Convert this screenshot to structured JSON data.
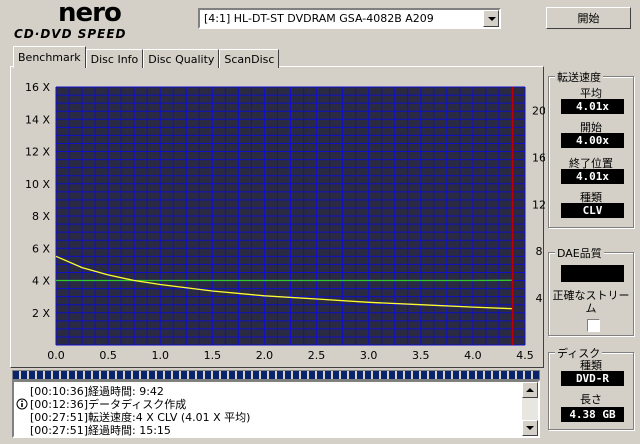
{
  "app": {
    "logo_text": "nero",
    "logo_subtext": "CD·DVD SPEED"
  },
  "drive": {
    "selected": "[4:1]   HL-DT-ST DVDRAM GSA-4082B  A209"
  },
  "toolbar": {
    "start_label": "開始"
  },
  "tabs": [
    {
      "label": "Benchmark",
      "active": true
    },
    {
      "label": "Disc Info",
      "active": false
    },
    {
      "label": "Disc Quality",
      "active": false
    },
    {
      "label": "ScanDisc",
      "active": false
    }
  ],
  "transfer": {
    "title": "転送速度",
    "average_label": "平均",
    "average_value": "4.01x",
    "start_label": "開始",
    "start_value": "4.00x",
    "end_label": "終了位置",
    "end_value": "4.01x",
    "type_label": "種類",
    "type_value": "CLV"
  },
  "dae": {
    "title": "DAE品質",
    "streaming_label": "正確なストリーム"
  },
  "disc": {
    "title": "ディスク",
    "type_label": "種類",
    "type_value": "DVD-R",
    "length_label": "長さ",
    "length_value": "4.38 GB"
  },
  "log": [
    {
      "time": "[00:10:36]",
      "text": "経過時間:  9:42",
      "icon": ""
    },
    {
      "time": "[00:12:36]",
      "text": "データディスク作成",
      "icon": "info-icon"
    },
    {
      "time": "[00:27:51]",
      "text": "転送速度:4 X CLV (4.01 X 平均)",
      "icon": ""
    },
    {
      "time": "[00:27:51]",
      "text": "経過時間: 15:15",
      "icon": ""
    }
  ],
  "colors": {
    "plot_bg": "#2a2a42",
    "grid": "#1010c8",
    "speed_line": "#ffff30",
    "rpm_line": "#30c830",
    "end_marker": "#c00000"
  },
  "chart_data": {
    "type": "line",
    "xlim": [
      0,
      4.5
    ],
    "ylim_left": [
      0,
      16
    ],
    "ylim_right": [
      0,
      22
    ],
    "x_ticks": [
      "0.0",
      "0.5",
      "1.0",
      "1.5",
      "2.0",
      "2.5",
      "3.0",
      "3.5",
      "4.0",
      "4.5"
    ],
    "y_ticks_left": [
      "2 X",
      "4 X",
      "6 X",
      "8 X",
      "10 X",
      "12 X",
      "14 X",
      "16 X"
    ],
    "y_ticks_right": [
      "4",
      "8",
      "12",
      "16",
      "20"
    ],
    "end_marker_x": 4.38,
    "series": [
      {
        "x": [
          0.0,
          0.25,
          0.5,
          0.75,
          1.0,
          1.5,
          2.0,
          2.5,
          3.0,
          3.5,
          4.0,
          4.38
        ],
        "values": [
          4.0,
          4.0,
          4.0,
          4.0,
          4.0,
          4.0,
          4.0,
          4.0,
          4.0,
          4.0,
          4.0,
          4.01
        ]
      },
      {
        "x": [
          0.0,
          0.25,
          0.5,
          0.75,
          1.0,
          1.5,
          2.0,
          2.5,
          3.0,
          3.5,
          4.0,
          4.38
        ],
        "values": [
          5.5,
          4.8,
          4.35,
          4.0,
          3.75,
          3.35,
          3.05,
          2.85,
          2.65,
          2.5,
          2.35,
          2.25
        ]
      }
    ]
  }
}
